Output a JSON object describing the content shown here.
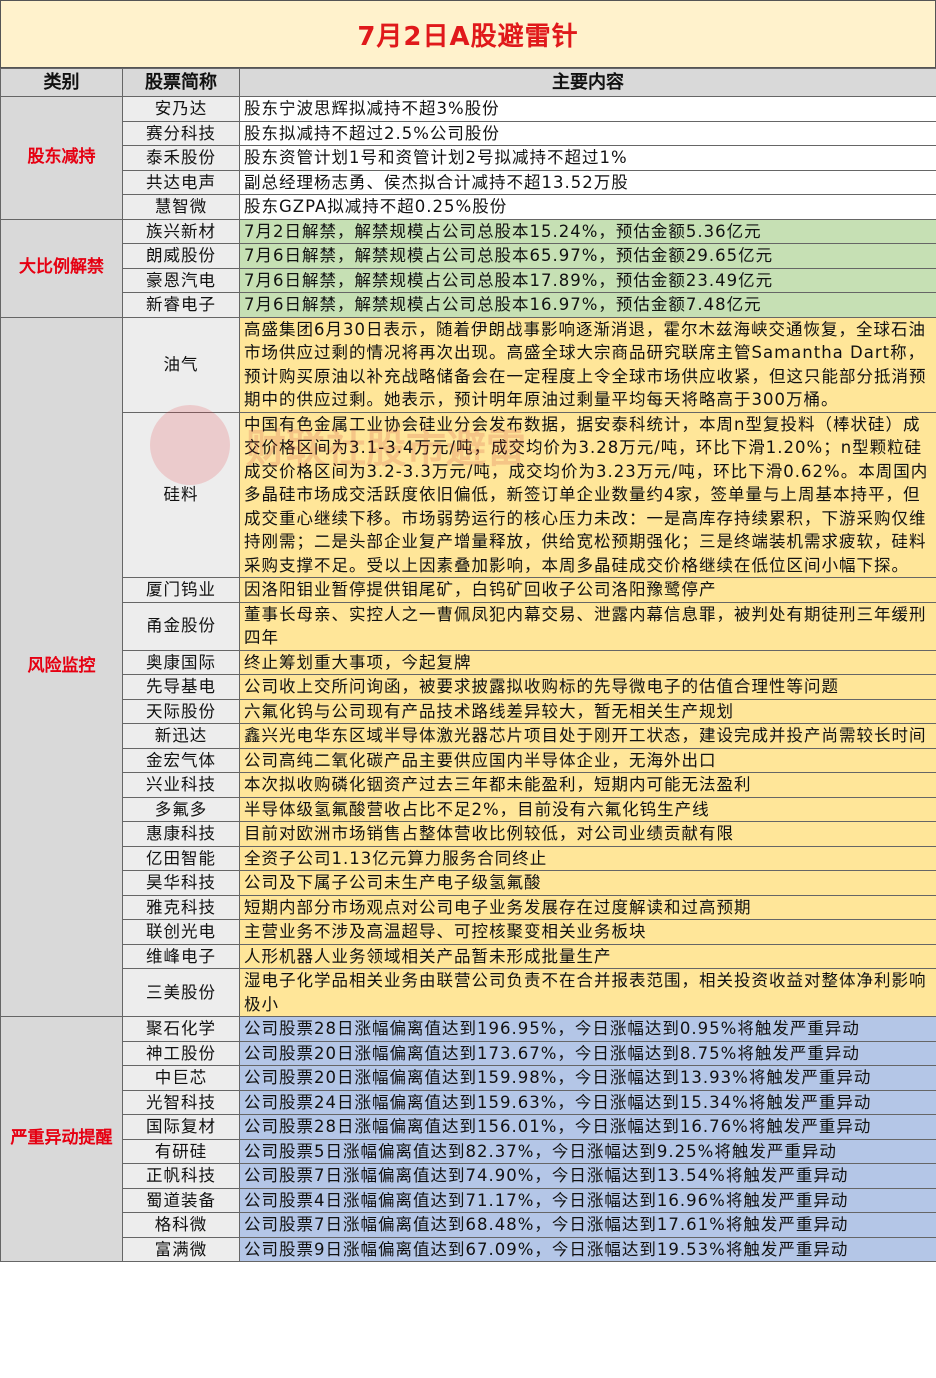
{
  "title": "7月2日A股避雷针",
  "headers": [
    "类别",
    "股票简称",
    "主要内容"
  ],
  "watermark_text": "财联社股市避雷",
  "watermark_logo": "cls-logo-icon",
  "groups": [
    {
      "category": "股东减持",
      "color": "#ffffff",
      "rows": [
        {
          "name": "安乃达",
          "content": "股东宁波思辉拟减持不超3%股份"
        },
        {
          "name": "赛分科技",
          "content": "股东拟减持不超过2.5%公司股份"
        },
        {
          "name": "泰禾股份",
          "content": "股东资管计划1号和资管计划2号拟减持不超过1%"
        },
        {
          "name": "共达电声",
          "content": "副总经理杨志勇、侯杰拟合计减持不超13.52万股"
        },
        {
          "name": "慧智微",
          "content": "股东GZPA拟减持不超0.25%股份"
        }
      ]
    },
    {
      "category": "大比例解禁",
      "color": "#c6e0b4",
      "rows": [
        {
          "name": "族兴新材",
          "content": "7月2日解禁，解禁规模占公司总股本15.24%，预估金额5.36亿元"
        },
        {
          "name": "朗威股份",
          "content": "7月6日解禁，解禁规模占公司总股本65.97%，预估金额29.65亿元"
        },
        {
          "name": "豪恩汽电",
          "content": "7月6日解禁，解禁规模占公司总股本17.89%，预估金额23.49亿元"
        },
        {
          "name": "新睿电子",
          "content": "7月6日解禁，解禁规模占公司总股本16.97%，预估金额7.48亿元"
        }
      ]
    },
    {
      "category": "风险监控",
      "color": "#ffe699",
      "rows": [
        {
          "name": "油气",
          "content": "高盛集团6月30日表示，随着伊朗战事影响逐渐消退，霍尔木兹海峡交通恢复，全球石油市场供应过剩的情况将再次出现。高盛全球大宗商品研究联席主管Samantha Dart称，预计购买原油以补充战略储备会在一定程度上令全球市场供应收紧，但这只能部分抵消预期中的供应过剩。她表示，预计明年原油过剩量平均每天将略高于300万桶。"
        },
        {
          "name": "硅料",
          "content": "中国有色金属工业协会硅业分会发布数据，据安泰科统计，本周n型复投料（棒状硅）成交价格区间为3.1-3.4万元/吨，成交均价为3.28万元/吨，环比下滑1.20%；n型颗粒硅成交价格区间为3.2-3.3万元/吨，成交均价为3.23万元/吨，环比下滑0.62%。本周国内多晶硅市场成交活跃度依旧偏低，新签订单企业数量约4家，签单量与上周基本持平，但成交重心继续下移。市场弱势运行的核心压力未改：一是高库存持续累积，下游采购仅维持刚需；二是头部企业复产增量释放，供给宽松预期强化；三是终端装机需求疲软，硅料采购支撑不足。受以上因素叠加影响，本周多晶硅成交价格继续在低位区间小幅下探。"
        },
        {
          "name": "厦门钨业",
          "content": "因洛阳钼业暂停提供钼尾矿，白钨矿回收子公司洛阳豫鹭停产"
        },
        {
          "name": "甬金股份",
          "content": "董事长母亲、实控人之一曹佩凤犯内幕交易、泄露内幕信息罪，被判处有期徒刑三年缓刑四年"
        },
        {
          "name": "奥康国际",
          "content": "终止筹划重大事项，今起复牌"
        },
        {
          "name": "先导基电",
          "content": "公司收上交所问询函，被要求披露拟收购标的先导微电子的估值合理性等问题"
        },
        {
          "name": "天际股份",
          "content": "六氟化钨与公司现有产品技术路线差异较大，暂无相关生产规划"
        },
        {
          "name": "新迅达",
          "content": "鑫兴光电华东区域半导体激光器芯片项目处于刚开工状态，建设完成并投产尚需较长时间"
        },
        {
          "name": "金宏气体",
          "content": "公司高纯二氧化碳产品主要供应国内半导体企业，无海外出口"
        },
        {
          "name": "兴业科技",
          "content": "本次拟收购磷化铟资产过去三年都未能盈利，短期内可能无法盈利"
        },
        {
          "name": "多氟多",
          "content": "半导体级氢氟酸营收占比不足2%，目前没有六氟化钨生产线"
        },
        {
          "name": "惠康科技",
          "content": "目前对欧洲市场销售占整体营收比例较低，对公司业绩贡献有限"
        },
        {
          "name": "亿田智能",
          "content": "全资子公司1.13亿元算力服务合同终止"
        },
        {
          "name": "昊华科技",
          "content": "公司及下属子公司未生产电子级氢氟酸"
        },
        {
          "name": "雅克科技",
          "content": "短期内部分市场观点对公司电子业务发展存在过度解读和过高预期"
        },
        {
          "name": "联创光电",
          "content": "主营业务不涉及高温超导、可控核聚变相关业务板块"
        },
        {
          "name": "维峰电子",
          "content": "人形机器人业务领域相关产品暂未形成批量生产"
        },
        {
          "name": "三美股份",
          "content": "湿电子化学品相关业务由联营公司负责不在合并报表范围，相关投资收益对整体净利影响极小"
        }
      ]
    },
    {
      "category": "严重异动提醒",
      "color": "#b4c6e7",
      "rows": [
        {
          "name": "聚石化学",
          "content": "公司股票28日涨幅偏离值达到196.95%，今日涨幅达到0.95%将触发严重异动"
        },
        {
          "name": "神工股份",
          "content": "公司股票20日涨幅偏离值达到173.67%，今日涨幅达到8.75%将触发严重异动"
        },
        {
          "name": "中巨芯",
          "content": "公司股票20日涨幅偏离值达到159.98%，今日涨幅达到13.93%将触发严重异动"
        },
        {
          "name": "光智科技",
          "content": "公司股票24日涨幅偏离值达到159.63%，今日涨幅达到15.34%将触发严重异动"
        },
        {
          "name": "国际复材",
          "content": "公司股票28日涨幅偏离值达到156.01%，今日涨幅达到16.76%将触发严重异动"
        },
        {
          "name": "有研硅",
          "content": "公司股票5日涨幅偏离值达到82.37%，今日涨幅达到9.25%将触发严重异动"
        },
        {
          "name": "正帆科技",
          "content": "公司股票7日涨幅偏离值达到74.90%，今日涨幅达到13.54%将触发严重异动"
        },
        {
          "name": "蜀道装备",
          "content": "公司股票4日涨幅偏离值达到71.17%，今日涨幅达到16.96%将触发严重异动"
        },
        {
          "name": "格科微",
          "content": "公司股票7日涨幅偏离值达到68.48%，今日涨幅达到17.61%将触发严重异动"
        },
        {
          "name": "富满微",
          "content": "公司股票9日涨幅偏离值达到67.09%，今日涨幅达到19.53%将触发严重异动"
        }
      ]
    }
  ]
}
